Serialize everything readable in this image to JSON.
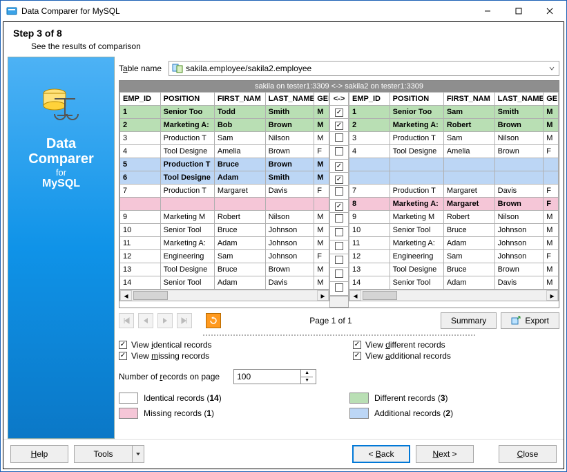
{
  "window": {
    "title": "Data Comparer for MySQL"
  },
  "step": {
    "heading": "Step 3 of 8",
    "subtitle": "See the results of comparison"
  },
  "sidebar": {
    "line1": "Data",
    "line2": "Comparer",
    "line3": "for",
    "line4": "MySQL"
  },
  "tablename": {
    "label_pre": "T",
    "label_underline": "a",
    "label_post": "ble name",
    "value": "sakila.employee/sakila2.employee"
  },
  "compare_header": "sakila on tester1:3309 <-> sakila2 on tester1:3309",
  "columns": {
    "emp_id": "EMP_ID",
    "position": "POSITION",
    "first_name": "FIRST_NAM",
    "last_name": "LAST_NAME",
    "gender_left": "GEND",
    "gender_right": "GE",
    "middle": "<->"
  },
  "left_rows": [
    {
      "cls": "diff",
      "bold": true,
      "id": "1",
      "pos": "Senior Too",
      "fn": "Todd",
      "ln": "Smith",
      "g": "M",
      "chk": true
    },
    {
      "cls": "diff",
      "bold": true,
      "id": "2",
      "pos": "Marketing A:",
      "fn": "Bob",
      "ln": "Brown",
      "g": "M",
      "chk": true
    },
    {
      "cls": "",
      "id": "3",
      "pos": "Production T",
      "fn": "Sam",
      "ln": "Nilson",
      "g": "M",
      "chk": false
    },
    {
      "cls": "",
      "id": "4",
      "pos": "Tool Designe",
      "fn": "Amelia",
      "ln": "Brown",
      "g": "F",
      "chk": false
    },
    {
      "cls": "add",
      "bold": true,
      "id": "5",
      "pos": "Production T",
      "fn": "Bruce",
      "ln": "Brown",
      "g": "M",
      "chk": true
    },
    {
      "cls": "add",
      "bold": true,
      "id": "6",
      "pos": "Tool Designe",
      "fn": "Adam",
      "ln": "Smith",
      "g": "M",
      "chk": true
    },
    {
      "cls": "",
      "id": "7",
      "pos": "Production T",
      "fn": "Margaret",
      "ln": "Davis",
      "g": "F",
      "chk": false
    },
    {
      "cls": "miss",
      "id": "",
      "pos": "",
      "fn": "",
      "ln": "",
      "g": "",
      "chk": true
    },
    {
      "cls": "",
      "id": "9",
      "pos": "Marketing M",
      "fn": "Robert",
      "ln": "Nilson",
      "g": "M",
      "chk": false
    },
    {
      "cls": "",
      "id": "10",
      "pos": "Senior Tool",
      "fn": "Bruce",
      "ln": "Johnson",
      "g": "M",
      "chk": false
    },
    {
      "cls": "",
      "id": "11",
      "pos": "Marketing A:",
      "fn": "Adam",
      "ln": "Johnson",
      "g": "M",
      "chk": false
    },
    {
      "cls": "",
      "id": "12",
      "pos": "Engineering",
      "fn": "Sam",
      "ln": "Johnson",
      "g": "F",
      "chk": false
    },
    {
      "cls": "",
      "id": "13",
      "pos": "Tool Designe",
      "fn": "Bruce",
      "ln": "Brown",
      "g": "M",
      "chk": false
    },
    {
      "cls": "",
      "id": "14",
      "pos": "Senior Tool",
      "fn": "Adam",
      "ln": "Davis",
      "g": "M",
      "chk": false
    }
  ],
  "right_rows": [
    {
      "cls": "diff",
      "bold": true,
      "id": "1",
      "pos": "Senior Too",
      "fn": "Sam",
      "ln": "Smith",
      "g": "M"
    },
    {
      "cls": "diff",
      "bold": true,
      "id": "2",
      "pos": "Marketing A:",
      "fn": "Robert",
      "ln": "Brown",
      "g": "M"
    },
    {
      "cls": "",
      "id": "3",
      "pos": "Production T",
      "fn": "Sam",
      "ln": "Nilson",
      "g": "M"
    },
    {
      "cls": "",
      "id": "4",
      "pos": "Tool Designe",
      "fn": "Amelia",
      "ln": "Brown",
      "g": "F"
    },
    {
      "cls": "add",
      "id": "",
      "pos": "",
      "fn": "",
      "ln": "",
      "g": ""
    },
    {
      "cls": "add",
      "id": "",
      "pos": "",
      "fn": "",
      "ln": "",
      "g": ""
    },
    {
      "cls": "",
      "id": "7",
      "pos": "Production T",
      "fn": "Margaret",
      "ln": "Davis",
      "g": "F"
    },
    {
      "cls": "miss",
      "bold": true,
      "id": "8",
      "pos": "Marketing A:",
      "fn": "Margaret",
      "ln": "Brown",
      "g": "F"
    },
    {
      "cls": "",
      "id": "9",
      "pos": "Marketing M",
      "fn": "Robert",
      "ln": "Nilson",
      "g": "M"
    },
    {
      "cls": "",
      "id": "10",
      "pos": "Senior Tool",
      "fn": "Bruce",
      "ln": "Johnson",
      "g": "M"
    },
    {
      "cls": "",
      "id": "11",
      "pos": "Marketing A:",
      "fn": "Adam",
      "ln": "Johnson",
      "g": "M"
    },
    {
      "cls": "",
      "id": "12",
      "pos": "Engineering",
      "fn": "Sam",
      "ln": "Johnson",
      "g": "F"
    },
    {
      "cls": "",
      "id": "13",
      "pos": "Tool Designe",
      "fn": "Bruce",
      "ln": "Brown",
      "g": "M"
    },
    {
      "cls": "",
      "id": "14",
      "pos": "Senior Tool",
      "fn": "Adam",
      "ln": "Davis",
      "g": "M"
    }
  ],
  "pager": {
    "page_label": "Page 1 of 1",
    "summary": "Summary",
    "export": "Export"
  },
  "options": {
    "view_identical": {
      "pre": "View ",
      "u": "i",
      "post": "dentical records",
      "checked": true
    },
    "view_different": {
      "pre": "View ",
      "u": "d",
      "post": "ifferent records",
      "checked": true
    },
    "view_missing": {
      "pre": "View ",
      "u": "m",
      "post": "issing records",
      "checked": true
    },
    "view_additional": {
      "pre": "View ",
      "u": "a",
      "post": "dditional records",
      "checked": true
    }
  },
  "records_per_page": {
    "label_pre": "Number of ",
    "label_u": "r",
    "label_post": "ecords on page",
    "value": "100"
  },
  "legend": {
    "identical": {
      "label": "Identical records (",
      "n": "14",
      "post": ")"
    },
    "different": {
      "label": "Different records (",
      "n": "3",
      "post": ")"
    },
    "missing": {
      "label": "Missing records (",
      "n": "1",
      "post": ")"
    },
    "additional": {
      "label": "Additional records (",
      "n": "2",
      "post": ")"
    }
  },
  "footer": {
    "help": {
      "u": "H",
      "post": "elp"
    },
    "tools": "Tools",
    "back": {
      "pre": "< ",
      "u": "B",
      "post": "ack"
    },
    "next": {
      "u": "N",
      "post": "ext >"
    },
    "close": {
      "u": "C",
      "post": "lose"
    }
  }
}
